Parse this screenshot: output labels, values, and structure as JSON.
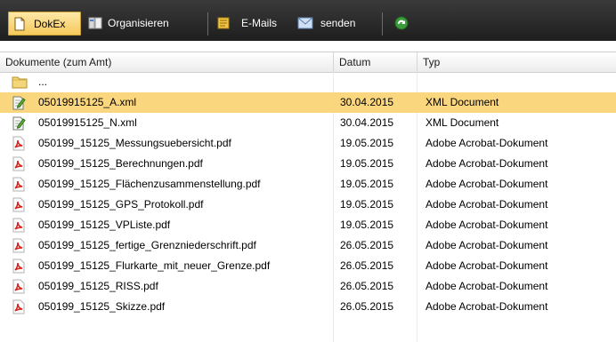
{
  "toolbar": {
    "dokex_label": "DokEx",
    "organize_label": "Organisieren",
    "emails_label": "E-Mails",
    "send_label": "senden"
  },
  "columns": {
    "name": "Dokumente   (zum Amt)",
    "date": "Datum",
    "type": "Typ"
  },
  "rows": [
    {
      "icon": "folder-icon",
      "name": "...",
      "date": "",
      "type": ""
    },
    {
      "icon": "xml-document-icon",
      "name": "05019915125_A.xml",
      "date": "30.04.2015",
      "type": "XML Document",
      "selected": true
    },
    {
      "icon": "xml-document-icon",
      "name": "05019915125_N.xml",
      "date": "30.04.2015",
      "type": "XML Document"
    },
    {
      "icon": "pdf-icon",
      "name": "050199_15125_Messungsuebersicht.pdf",
      "date": "19.05.2015",
      "type": "Adobe Acrobat-Dokument"
    },
    {
      "icon": "pdf-icon",
      "name": "050199_15125_Berechnungen.pdf",
      "date": "19.05.2015",
      "type": "Adobe Acrobat-Dokument"
    },
    {
      "icon": "pdf-icon",
      "name": "050199_15125_Flächenzusammenstellung.pdf",
      "date": "19.05.2015",
      "type": "Adobe Acrobat-Dokument"
    },
    {
      "icon": "pdf-icon",
      "name": "050199_15125_GPS_Protokoll.pdf",
      "date": "19.05.2015",
      "type": "Adobe Acrobat-Dokument"
    },
    {
      "icon": "pdf-icon",
      "name": "050199_15125_VPListe.pdf",
      "date": "19.05.2015",
      "type": "Adobe Acrobat-Dokument"
    },
    {
      "icon": "pdf-icon",
      "name": "050199_15125_fertige_Grenzniederschrift.pdf",
      "date": "26.05.2015",
      "type": "Adobe Acrobat-Dokument"
    },
    {
      "icon": "pdf-icon",
      "name": "050199_15125_Flurkarte_mit_neuer_Grenze.pdf",
      "date": "26.05.2015",
      "type": "Adobe Acrobat-Dokument"
    },
    {
      "icon": "pdf-icon",
      "name": "050199_15125_RISS.pdf",
      "date": "26.05.2015",
      "type": "Adobe Acrobat-Dokument"
    },
    {
      "icon": "pdf-icon",
      "name": "050199_15125_Skizze.pdf",
      "date": "26.05.2015",
      "type": "Adobe Acrobat-Dokument"
    }
  ],
  "colors": {
    "selection": "#fad67e",
    "toolbar_bg": "#2b2b2b",
    "active_button": "#f6c95b"
  }
}
